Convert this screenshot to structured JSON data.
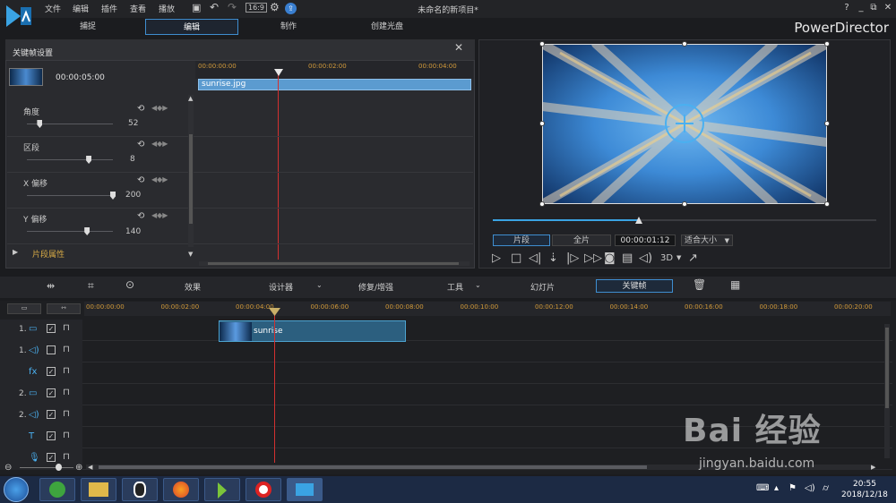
{
  "app": {
    "menu": [
      "文件",
      "编辑",
      "插件",
      "查看",
      "播放"
    ],
    "project_title": "未命名的新项目*",
    "brand": "PowerDirector",
    "window_controls": [
      "?",
      "_",
      "⧉",
      "✕"
    ]
  },
  "tabs": [
    "捕捉",
    "编辑",
    "制作",
    "创建光盘"
  ],
  "keyframe_panel": {
    "title": "关键帧设置",
    "duration": "00:00:05:00",
    "ruler_ticks": [
      "00:00:00:00",
      "00:00:02:00",
      "00:00:04:00"
    ],
    "clip_name": "sunrise.jpg",
    "params": [
      {
        "label": "角度",
        "value": "52",
        "slider": 0.15
      },
      {
        "label": "区段",
        "value": "8",
        "slider": 0.72
      },
      {
        "label": "X 偏移",
        "value": "200",
        "slider": 1.0
      },
      {
        "label": "Y 偏移",
        "value": "140",
        "slider": 0.7
      }
    ],
    "section_label": "片段属性"
  },
  "preview": {
    "mode_clip": "片段",
    "mode_full": "全片",
    "timecode": "00:00:01:12",
    "fit": "适合大小",
    "progress": 0.38,
    "label_3d": "3D"
  },
  "toolbar2": {
    "effects": "效果",
    "designer": "设计器",
    "repair": "修复/增强",
    "tools": "工具",
    "slideshow": "幻灯片",
    "keyframe": "关键帧"
  },
  "timeline": {
    "ticks": [
      "00:00:00:00",
      "00:00:02:00",
      "00:00:04:00",
      "00:00:06:00",
      "00:00:08:00",
      "00:00:10:00",
      "00:00:12:00",
      "00:00:14:00",
      "00:00:16:00",
      "00:00:18:00",
      "00:00:20:00"
    ],
    "clip_name": "sunrise",
    "tracks": [
      {
        "label": "1.",
        "icon": "video-track-icon"
      },
      {
        "label": "1.",
        "icon": "audio-track-icon"
      },
      {
        "label": "",
        "icon": "fx-track-icon"
      },
      {
        "label": "2.",
        "icon": "video-track-icon"
      },
      {
        "label": "2.",
        "icon": "audio-track-icon"
      },
      {
        "label": "",
        "icon": "title-track-icon"
      },
      {
        "label": "",
        "icon": "voice-track-icon"
      }
    ]
  },
  "taskbar": {
    "time": "20:55",
    "date": "2018/12/18"
  },
  "watermark": {
    "brand": "Bai 经验",
    "url": "jingyan.baidu.com"
  }
}
